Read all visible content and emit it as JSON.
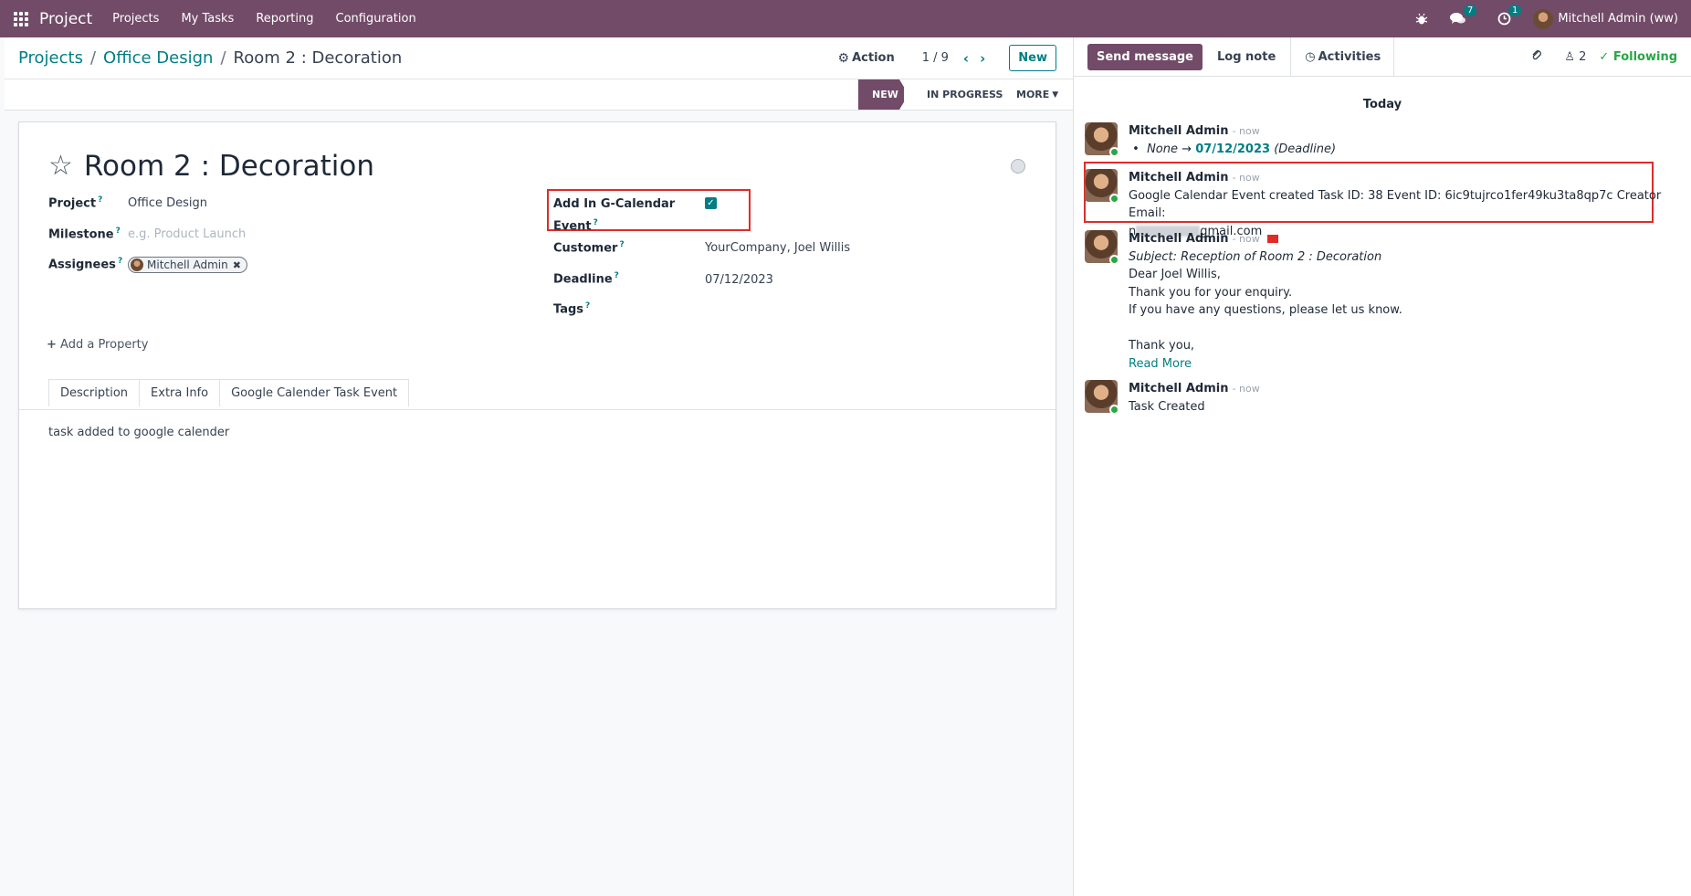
{
  "nav": {
    "brand": "Project",
    "menu": [
      "Projects",
      "My Tasks",
      "Reporting",
      "Configuration"
    ],
    "messages_badge": "7",
    "activities_badge": "1",
    "user": "Mitchell Admin (ww)"
  },
  "breadcrumb": {
    "root": "Projects",
    "parent": "Office Design",
    "current": "Room 2 : Decoration",
    "sep": "/"
  },
  "control": {
    "action_label": "Action",
    "pager": "1 / 9",
    "new_label": "New"
  },
  "statusbar": {
    "stages": [
      "NEW",
      "IN PROGRESS",
      "MORE"
    ],
    "active_stage": "NEW"
  },
  "form": {
    "title": "Room 2 : Decoration",
    "project_label": "Project",
    "project_value": "Office Design",
    "milestone_label": "Milestone",
    "milestone_placeholder": "e.g. Product Launch",
    "assignees_label": "Assignees",
    "assignee": "Mitchell Admin",
    "gcal_label_line1": "Add In G-Calendar",
    "gcal_label_line2": "Event",
    "gcal_checked": true,
    "customer_label": "Customer",
    "customer_value": "YourCompany, Joel Willis",
    "deadline_label": "Deadline",
    "deadline_value": "07/12/2023",
    "tags_label": "Tags",
    "help_mark": "?",
    "add_property": "Add a Property",
    "tabs": [
      "Description",
      "Extra Info",
      "Google Calender Task Event"
    ],
    "active_tab": "Description",
    "description": "task added to google calender"
  },
  "chatter": {
    "send_message": "Send message",
    "log_note": "Log note",
    "activities": "Activities",
    "followers_count": "2",
    "following": "Following",
    "today": "Today",
    "messages": [
      {
        "author": "Mitchell Admin",
        "time": "- now",
        "tracking_old": "None",
        "tracking_arrow": "→",
        "tracking_new": "07/12/2023",
        "tracking_field": "(Deadline)"
      },
      {
        "author": "Mitchell Admin",
        "time": "- now",
        "line1": "Google Calendar Event created Task ID: 38 Event ID: 6ic9tujrco1fer49ku3ta8qp7c Creator Email:",
        "email_prefix": "n",
        "email_suffix": "gmail.com"
      },
      {
        "author": "Mitchell Admin",
        "time": "- now",
        "subject": "Subject: Reception of Room 2 : Decoration",
        "line1": "Dear Joel Willis,",
        "line2": "Thank you for your enquiry.",
        "line3": "If you have any questions, please let us know.",
        "line4": "Thank you,",
        "read_more": "Read More"
      },
      {
        "author": "Mitchell Admin",
        "time": "- now",
        "body": "Task Created"
      }
    ]
  },
  "colors": {
    "brand": "#714b67",
    "accent": "#017e84",
    "highlight": "#e02b27",
    "following": "#28a745"
  }
}
